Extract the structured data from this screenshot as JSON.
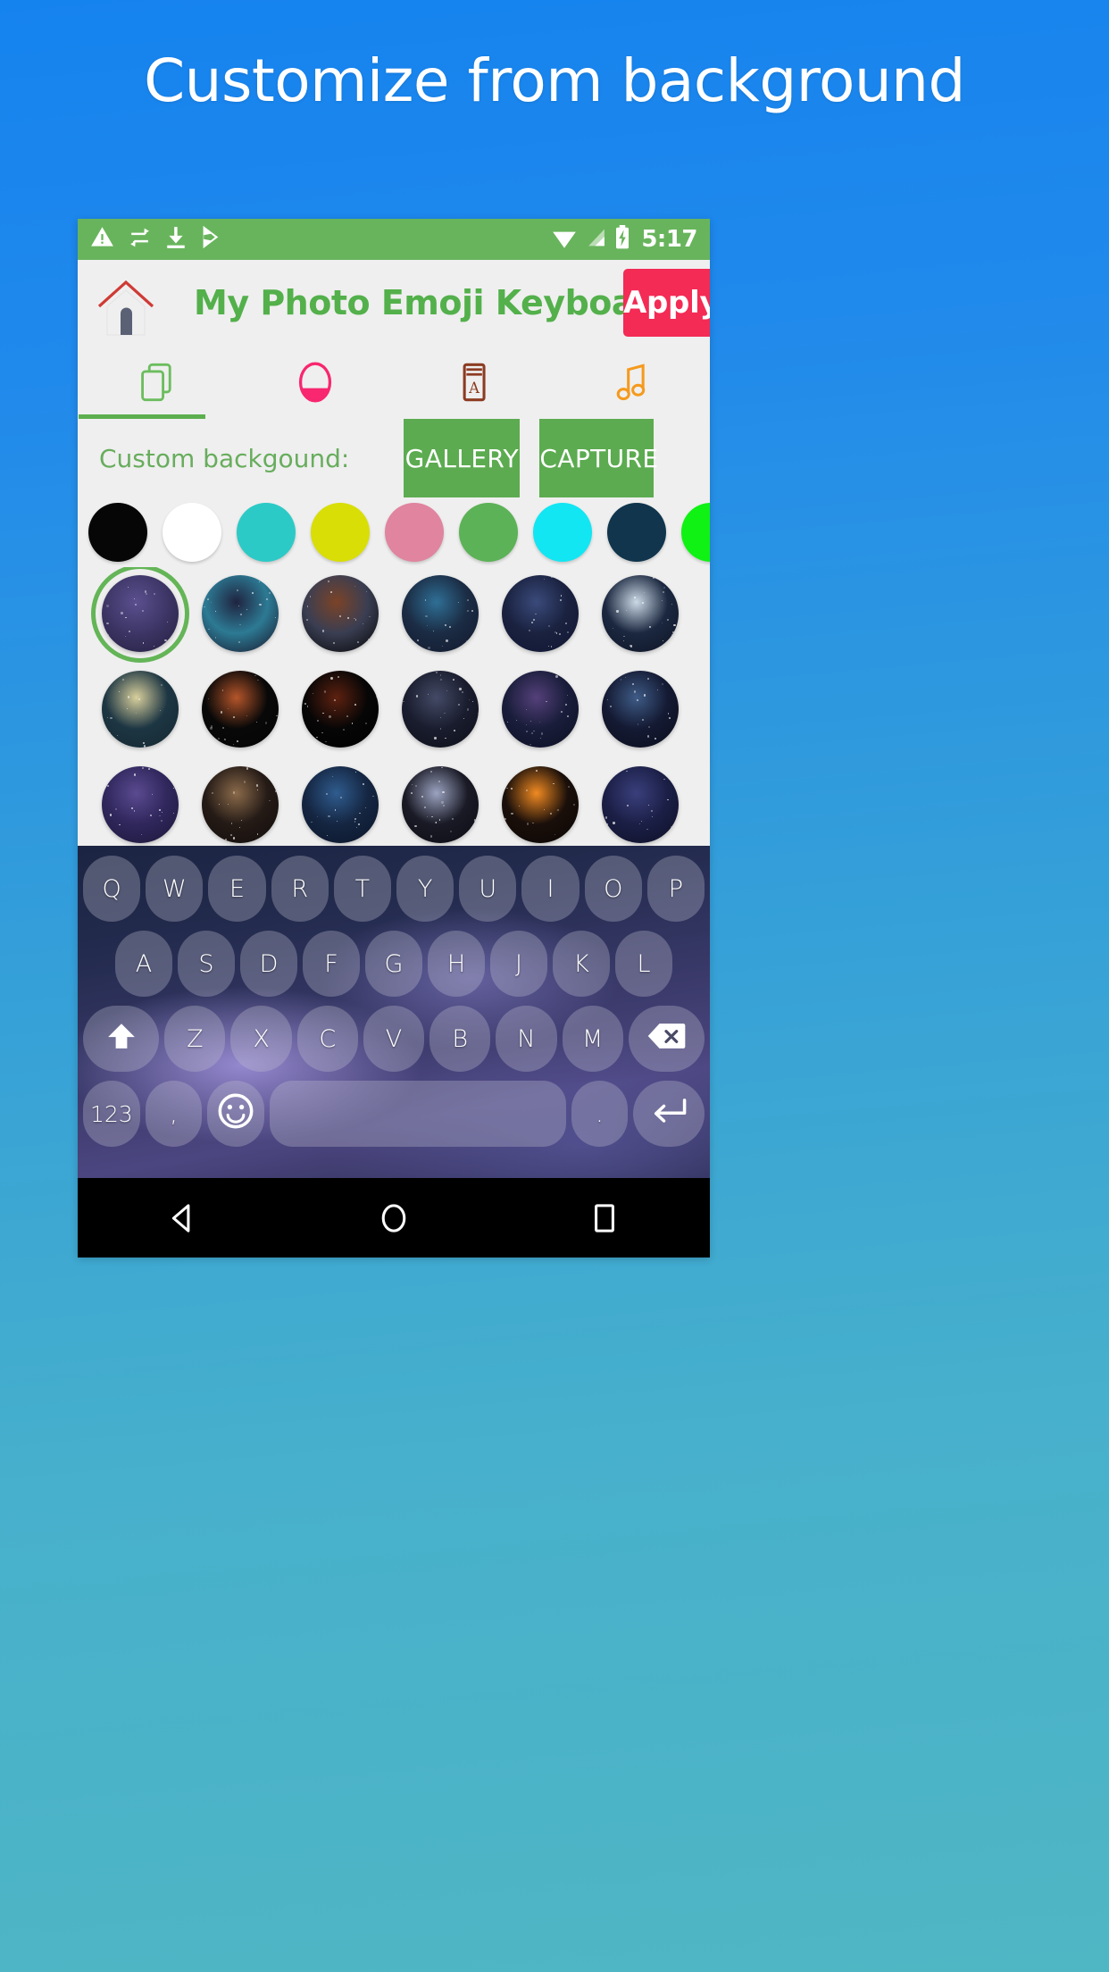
{
  "promo": {
    "headline": "Customize from background"
  },
  "status_bar": {
    "icons": [
      "warning-icon",
      "sync-icon",
      "download-icon",
      "play-store-icon"
    ],
    "wifi_icon": "wifi-icon",
    "signal_icon": "signal-icon",
    "battery_icon": "battery-charging-icon",
    "time": "5:17",
    "background_color": "#68b45c"
  },
  "app_bar": {
    "home_icon": "home-icon",
    "title": "My Photo Emoji Keyboard",
    "title_color": "#53b04b",
    "apply_label": "Apply",
    "apply_color": "#f32b55"
  },
  "tabs": [
    {
      "name": "layers-tab",
      "icon": "layers-icon",
      "color": "#6cbd5e",
      "active": true
    },
    {
      "name": "theme-tab",
      "icon": "theme-circle-icon",
      "color": "#f8276f",
      "active": false
    },
    {
      "name": "font-tab",
      "icon": "font-book-icon",
      "color": "#8c3b22",
      "active": false
    },
    {
      "name": "sound-tab",
      "icon": "music-note-icon",
      "color": "#f59a1e",
      "active": false
    }
  ],
  "custom_background": {
    "label": "Custom backgound:",
    "gallery_label": "GALLERY",
    "capture_label": "CAPTURE",
    "button_color": "#5cab50"
  },
  "color_swatches": [
    {
      "name": "black",
      "hex": "#060606"
    },
    {
      "name": "white",
      "hex": "#ffffff"
    },
    {
      "name": "turquoise",
      "hex": "#2ccac6"
    },
    {
      "name": "yellow-green",
      "hex": "#d9de06"
    },
    {
      "name": "pink",
      "hex": "#e0849f"
    },
    {
      "name": "green",
      "hex": "#5cb257"
    },
    {
      "name": "cyan",
      "hex": "#12e6f3"
    },
    {
      "name": "navy",
      "hex": "#10354d"
    },
    {
      "name": "bright-green",
      "hex": "#0ff214"
    }
  ],
  "wallpaper_thumbnails": [
    [
      {
        "name": "purple-galaxy",
        "selected": true,
        "c1": "#3d3666",
        "c2": "#5b4f8e",
        "c3": "#231f3f"
      },
      {
        "name": "forest-night-sky",
        "selected": false,
        "c1": "#2d7a94",
        "c2": "#1f2440",
        "c3": "#161226"
      },
      {
        "name": "dark-horizon-sunset",
        "selected": false,
        "c1": "#3a3e52",
        "c2": "#7b4327",
        "c3": "#030303"
      },
      {
        "name": "blue-milky-way",
        "selected": false,
        "c1": "#1b2c44",
        "c2": "#2f6f95",
        "c3": "#12182c"
      },
      {
        "name": "deep-blue-stars",
        "selected": false,
        "c1": "#1a2240",
        "c2": "#3a4a7a",
        "c3": "#101531"
      },
      {
        "name": "hot-air-balloon-moon",
        "selected": false,
        "c1": "#1b2840",
        "c2": "#cbd9e6",
        "c3": "#0e1324"
      }
    ],
    [
      {
        "name": "full-moon-teal",
        "selected": false,
        "c1": "#1d3643",
        "c2": "#d8cf9c",
        "c3": "#142730"
      },
      {
        "name": "eclipse-sequence",
        "selected": false,
        "c1": "#080808",
        "c2": "#b4552a",
        "c3": "#050505"
      },
      {
        "name": "lunar-eclipse",
        "selected": false,
        "c1": "#060606",
        "c2": "#5d2110",
        "c3": "#000000"
      },
      {
        "name": "faint-moon-night",
        "selected": false,
        "c1": "#1a1d2e",
        "c2": "#444a66",
        "c3": "#0c0e18"
      },
      {
        "name": "violet-galaxy",
        "selected": false,
        "c1": "#191d3a",
        "c2": "#54407a",
        "c3": "#0c0f22"
      },
      {
        "name": "milky-way-core",
        "selected": false,
        "c1": "#141a33",
        "c2": "#3e5b86",
        "c3": "#0a0d1c"
      }
    ],
    [
      {
        "name": "purple-mountain-sky",
        "selected": false,
        "c1": "#30275c",
        "c2": "#5a4a90",
        "c3": "#1c1738"
      },
      {
        "name": "brown-milky-way",
        "selected": false,
        "c1": "#241a16",
        "c2": "#8a6a4a",
        "c3": "#120d0a"
      },
      {
        "name": "blue-night-sky",
        "selected": false,
        "c1": "#152642",
        "c2": "#2f5c8e",
        "c3": "#0a1428"
      },
      {
        "name": "spiral-galaxy",
        "selected": false,
        "c1": "#1a1a26",
        "c2": "#9ba3c0",
        "c3": "#0c0c14"
      },
      {
        "name": "orange-nebula",
        "selected": false,
        "c1": "#1a0f0a",
        "c2": "#f08a22",
        "c3": "#0a0604"
      },
      {
        "name": "indigo-starfield",
        "selected": false,
        "c1": "#1b1f46",
        "c2": "#3a3f7c",
        "c3": "#0d0f24"
      }
    ]
  ],
  "keyboard": {
    "rows": [
      [
        {
          "label": "Q",
          "name": "key-q",
          "type": "letter"
        },
        {
          "label": "W",
          "name": "key-w",
          "type": "letter"
        },
        {
          "label": "E",
          "name": "key-e",
          "type": "letter"
        },
        {
          "label": "R",
          "name": "key-r",
          "type": "letter"
        },
        {
          "label": "T",
          "name": "key-t",
          "type": "letter"
        },
        {
          "label": "Y",
          "name": "key-y",
          "type": "letter"
        },
        {
          "label": "U",
          "name": "key-u",
          "type": "letter"
        },
        {
          "label": "I",
          "name": "key-i",
          "type": "letter"
        },
        {
          "label": "O",
          "name": "key-o",
          "type": "letter"
        },
        {
          "label": "P",
          "name": "key-p",
          "type": "letter"
        }
      ],
      [
        {
          "label": "A",
          "name": "key-a",
          "type": "letter"
        },
        {
          "label": "S",
          "name": "key-s",
          "type": "letter"
        },
        {
          "label": "D",
          "name": "key-d",
          "type": "letter"
        },
        {
          "label": "F",
          "name": "key-f",
          "type": "letter"
        },
        {
          "label": "G",
          "name": "key-g",
          "type": "letter"
        },
        {
          "label": "H",
          "name": "key-h",
          "type": "letter"
        },
        {
          "label": "J",
          "name": "key-j",
          "type": "letter"
        },
        {
          "label": "K",
          "name": "key-k",
          "type": "letter"
        },
        {
          "label": "L",
          "name": "key-l",
          "type": "letter"
        }
      ],
      [
        {
          "label": "",
          "name": "key-shift",
          "type": "shift-icon"
        },
        {
          "label": "Z",
          "name": "key-z",
          "type": "letter"
        },
        {
          "label": "X",
          "name": "key-x",
          "type": "letter"
        },
        {
          "label": "C",
          "name": "key-c",
          "type": "letter"
        },
        {
          "label": "V",
          "name": "key-v",
          "type": "letter"
        },
        {
          "label": "B",
          "name": "key-b",
          "type": "letter"
        },
        {
          "label": "N",
          "name": "key-n",
          "type": "letter"
        },
        {
          "label": "M",
          "name": "key-m",
          "type": "letter"
        },
        {
          "label": "",
          "name": "key-backspace",
          "type": "backspace-icon"
        }
      ],
      [
        {
          "label": "123",
          "name": "key-numbers",
          "type": "letter"
        },
        {
          "label": ",",
          "name": "key-comma",
          "type": "letter"
        },
        {
          "label": "",
          "name": "key-emoji",
          "type": "emoji-icon"
        },
        {
          "label": "",
          "name": "key-space",
          "type": "space"
        },
        {
          "label": ".",
          "name": "key-period",
          "type": "letter"
        },
        {
          "label": "",
          "name": "key-enter",
          "type": "enter-icon"
        }
      ]
    ]
  },
  "nav_bar": {
    "buttons": [
      {
        "name": "nav-back-button",
        "icon": "back-triangle-icon"
      },
      {
        "name": "nav-home-button",
        "icon": "home-circle-icon"
      },
      {
        "name": "nav-recents-button",
        "icon": "recents-square-icon"
      }
    ]
  }
}
